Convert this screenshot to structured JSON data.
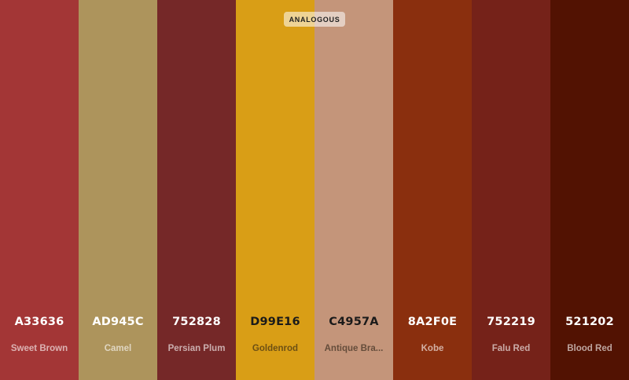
{
  "badge": {
    "label": "ANALOGOUS"
  },
  "swatches": [
    {
      "hex": "A33636",
      "name": "Sweet Brown",
      "color": "#A33636",
      "tone": "dark"
    },
    {
      "hex": "AD945C",
      "name": "Camel",
      "color": "#AD945C",
      "tone": "dark"
    },
    {
      "hex": "752828",
      "name": "Persian Plum",
      "color": "#752828",
      "tone": "dark"
    },
    {
      "hex": "D99E16",
      "name": "Goldenrod",
      "color": "#D99E16",
      "tone": "light"
    },
    {
      "hex": "C4957A",
      "name": "Antique Bra...",
      "color": "#C4957A",
      "tone": "light"
    },
    {
      "hex": "8A2F0E",
      "name": "Kobe",
      "color": "#8A2F0E",
      "tone": "dark"
    },
    {
      "hex": "752219",
      "name": "Falu Red",
      "color": "#752219",
      "tone": "dark"
    },
    {
      "hex": "521202",
      "name": "Blood Red",
      "color": "#521202",
      "tone": "dark"
    }
  ]
}
